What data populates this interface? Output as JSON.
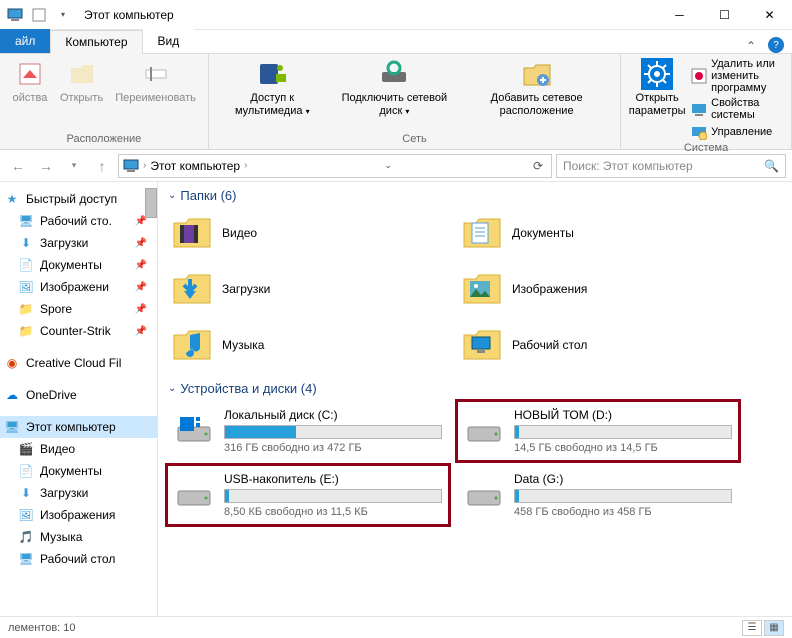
{
  "window": {
    "title": "Этот компьютер"
  },
  "tabs": {
    "file": "айл",
    "computer": "Компьютер",
    "view": "Вид"
  },
  "ribbon": {
    "group_location": "Расположение",
    "group_network": "Сеть",
    "group_system": "Система",
    "props": "ойства",
    "open": "Открыть",
    "rename": "Переименовать",
    "media_access": "Доступ к\nмультимедиа",
    "map_drive": "Подключить\nсетевой диск",
    "add_net": "Добавить сетевое\nрасположение",
    "open_settings": "Открыть\nпараметры",
    "uninstall": "Удалить или изменить программу",
    "sys_props": "Свойства системы",
    "manage": "Управление"
  },
  "address": {
    "crumb": "Этот компьютер",
    "search_placeholder": "Поиск: Этот компьютер"
  },
  "nav": {
    "quick": "Быстрый доступ",
    "desktop": "Рабочий сто.",
    "downloads": "Загрузки",
    "documents": "Документы",
    "pictures": "Изображени",
    "spore": "Spore",
    "cs": "Counter-Strik",
    "ccf": "Creative Cloud Fil",
    "onedrive": "OneDrive",
    "thispc": "Этот компьютер",
    "video": "Видео",
    "documents2": "Документы",
    "downloads2": "Загрузки",
    "pictures2": "Изображения",
    "music": "Музыка",
    "desktop2": "Рабочий стол"
  },
  "sections": {
    "folders": "Папки (6)",
    "drives": "Устройства и диски (4)"
  },
  "folders": {
    "video": "Видео",
    "documents": "Документы",
    "downloads": "Загрузки",
    "pictures": "Изображения",
    "music": "Музыка",
    "desktop": "Рабочий стол"
  },
  "drives": {
    "c": {
      "name": "Локальный диск (C:)",
      "free": "316 ГБ свободно из 472 ГБ",
      "fill": 33
    },
    "d": {
      "name": "НОВЫЙ ТОМ (D:)",
      "free": "14,5 ГБ свободно из 14,5 ГБ",
      "fill": 2
    },
    "e": {
      "name": "USB-накопитель (E:)",
      "free": "8,50 КБ свободно из 11,5 КБ",
      "fill": 2
    },
    "g": {
      "name": "Data (G:)",
      "free": "458 ГБ свободно из 458 ГБ",
      "fill": 2
    }
  },
  "status": {
    "items": "лементов: 10"
  }
}
